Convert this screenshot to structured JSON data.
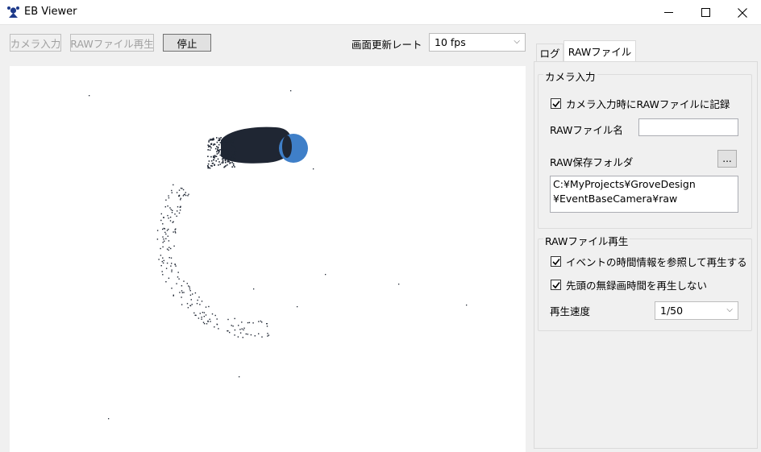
{
  "window": {
    "title": "EB Viewer"
  },
  "toolbar": {
    "camera_input_label": "カメラ入力",
    "raw_playback_label": "RAWファイル再生",
    "stop_label": "停止",
    "refresh_rate_label": "画面更新レート",
    "refresh_rate_value": "10 fps"
  },
  "tabs": [
    {
      "label": "ログ",
      "active": false
    },
    {
      "label": "RAWファイル",
      "active": true
    }
  ],
  "camera_group": {
    "title": "カメラ入力",
    "record_checkbox_label": "カメラ入力時にRAWファイルに記録",
    "record_checked": true,
    "raw_filename_label": "RAWファイル名",
    "raw_filename_value": "",
    "raw_folder_label": "RAW保存フォルダ",
    "browse_label": "...",
    "raw_folder_value": "C:¥MyProjects¥GroveDesign\n¥EventBaseCamera¥raw"
  },
  "playback_group": {
    "title": "RAWファイル再生",
    "use_timing_label": "イベントの時間情報を参照して再生する",
    "use_timing_checked": true,
    "skip_leading_label": "先頭の無録画時間を再生しない",
    "skip_leading_checked": true,
    "speed_label": "再生速度",
    "speed_value": "1/50"
  },
  "colors": {
    "event_dark": "#1f2633",
    "event_blue": "#3f7fc8",
    "canvas_bg": "#ffffff",
    "chrome_bg": "#f0f0f0"
  },
  "icons": {
    "app": "eb-viewer-app-icon",
    "minimize": "minimize-icon",
    "maximize": "maximize-icon",
    "close": "close-icon",
    "checkmark": "checkmark-icon",
    "dropdown": "chevron-down-icon"
  }
}
